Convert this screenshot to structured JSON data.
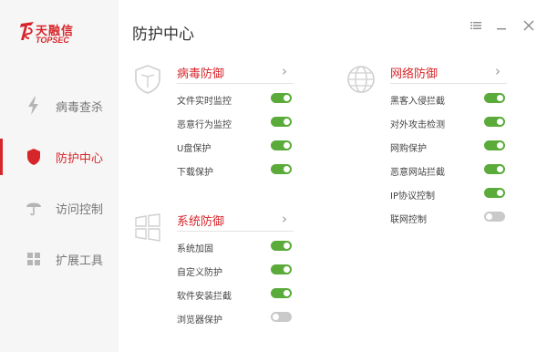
{
  "app": {
    "logo_cn": "天融信",
    "logo_en": "TOPSEC",
    "page_title": "防护中心"
  },
  "window": {
    "menu_icon": "list-icon",
    "minimize_icon": "minimize-icon",
    "close_icon": "close-icon"
  },
  "sidebar": {
    "items": [
      {
        "label": "病毒查杀",
        "icon": "lightning-icon",
        "active": false
      },
      {
        "label": "防护中心",
        "icon": "shield-icon",
        "active": true
      },
      {
        "label": "访问控制",
        "icon": "umbrella-icon",
        "active": false
      },
      {
        "label": "扩展工具",
        "icon": "grid-icon",
        "active": false
      }
    ]
  },
  "panels": {
    "virus": {
      "title": "病毒防御",
      "icon": "shield-outline-icon",
      "rows": [
        {
          "label": "文件实时监控",
          "on": true
        },
        {
          "label": "恶意行为监控",
          "on": true
        },
        {
          "label": "U盘保护",
          "on": true
        },
        {
          "label": "下载保护",
          "on": true
        }
      ]
    },
    "network": {
      "title": "网络防御",
      "icon": "globe-icon",
      "rows": [
        {
          "label": "黑客入侵拦截",
          "on": true
        },
        {
          "label": "对外攻击检测",
          "on": true
        },
        {
          "label": "网购保护",
          "on": true
        },
        {
          "label": "恶意网站拦截",
          "on": true
        },
        {
          "label": "IP协议控制",
          "on": true
        },
        {
          "label": "联网控制",
          "on": false
        }
      ]
    },
    "system": {
      "title": "系统防御",
      "icon": "windows-icon",
      "rows": [
        {
          "label": "系统加固",
          "on": true
        },
        {
          "label": "自定义防护",
          "on": true
        },
        {
          "label": "软件安装拦截",
          "on": true
        },
        {
          "label": "浏览器保护",
          "on": false
        }
      ]
    }
  },
  "colors": {
    "accent": "#d7262b",
    "toggle_on": "#5aab3a",
    "toggle_off": "#c9c9c9"
  }
}
